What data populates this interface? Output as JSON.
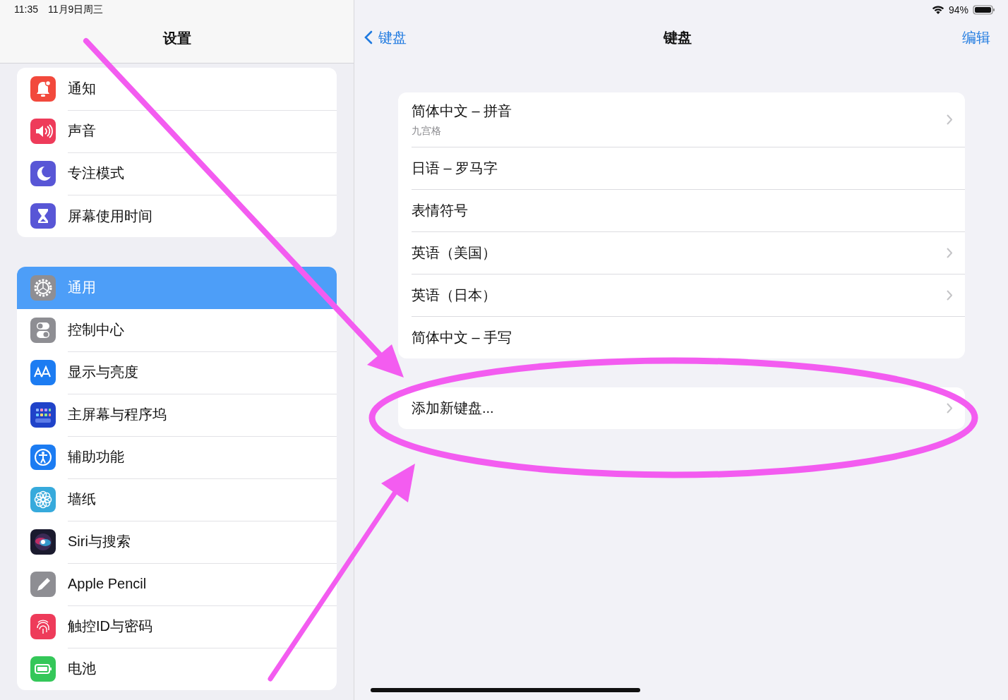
{
  "status_bar": {
    "time": "11:35",
    "date": "11月9日周三",
    "battery": "94%"
  },
  "sidebar": {
    "title": "设置",
    "groups": [
      {
        "items": [
          {
            "label": "通知",
            "selected": false
          },
          {
            "label": "声音",
            "selected": false
          },
          {
            "label": "专注模式",
            "selected": false
          },
          {
            "label": "屏幕使用时间",
            "selected": false
          }
        ]
      },
      {
        "items": [
          {
            "label": "通用",
            "selected": true
          },
          {
            "label": "控制中心",
            "selected": false
          },
          {
            "label": "显示与亮度",
            "selected": false
          },
          {
            "label": "主屏幕与程序坞",
            "selected": false
          },
          {
            "label": "辅助功能",
            "selected": false
          },
          {
            "label": "墙纸",
            "selected": false
          },
          {
            "label": "Siri与搜索",
            "selected": false
          },
          {
            "label": "Apple Pencil",
            "selected": false
          },
          {
            "label": "触控ID与密码",
            "selected": false
          },
          {
            "label": "电池",
            "selected": false
          }
        ]
      }
    ]
  },
  "detail": {
    "back": "键盘",
    "title": "键盘",
    "edit": "编辑",
    "keyboards": [
      {
        "title": "简体中文 – 拼音",
        "subtitle": "九宫格",
        "disclosure": true
      },
      {
        "title": "日语 – 罗马字",
        "disclosure": false
      },
      {
        "title": "表情符号",
        "disclosure": false
      },
      {
        "title": "英语（美国）",
        "disclosure": true
      },
      {
        "title": "英语（日本）",
        "disclosure": true
      },
      {
        "title": "简体中文 – 手写",
        "disclosure": false
      }
    ],
    "add_keyboard": {
      "title": "添加新键盘...",
      "disclosure": true
    }
  }
}
